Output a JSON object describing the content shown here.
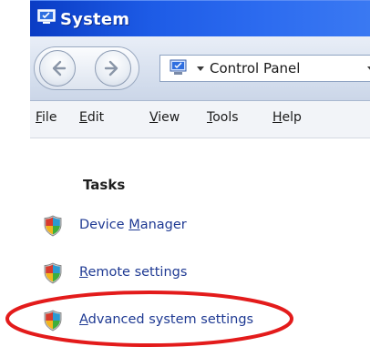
{
  "window": {
    "title": "System",
    "icon": "system-monitor-icon"
  },
  "nav": {
    "back_icon": "back-arrow-icon",
    "forward_icon": "forward-arrow-icon",
    "address_icon": "control-panel-icon",
    "address_breadcrumb": "Control Panel"
  },
  "menu": {
    "items": [
      {
        "underlined": "F",
        "rest": "ile"
      },
      {
        "underlined": "E",
        "rest": "dit"
      },
      {
        "underlined": "V",
        "rest": "iew"
      },
      {
        "underlined": "T",
        "rest": "ools"
      },
      {
        "underlined": "H",
        "rest": "elp"
      }
    ]
  },
  "tasks": {
    "heading": "Tasks",
    "items": [
      {
        "before": "Device ",
        "underlined": "M",
        "after": "anager",
        "icon": "uac-shield-icon"
      },
      {
        "before": "",
        "underlined": "R",
        "after": "emote settings",
        "icon": "uac-shield-icon"
      },
      {
        "before": "",
        "underlined": "A",
        "after": "dvanced system settings",
        "icon": "uac-shield-icon"
      }
    ]
  },
  "annotation": {
    "shape": "ellipse",
    "color": "#e31b1b",
    "target": "Advanced system settings"
  },
  "colors": {
    "titlebar_start": "#0a3cc4",
    "titlebar_end": "#3a79f2",
    "link": "#1f3a93",
    "highlight": "#e31b1b"
  }
}
